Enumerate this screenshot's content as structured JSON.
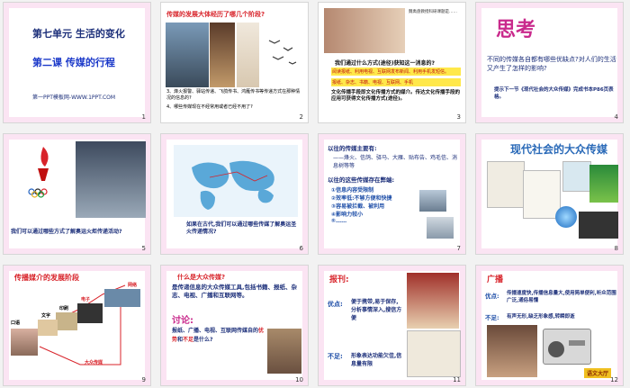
{
  "slides": [
    {
      "num": "1",
      "title": "第七单元  生活的变化",
      "subtitle": "第二课  传媒的行程",
      "footer": "第一PPT模板网-WWW.1PPT.COM"
    },
    {
      "num": "2",
      "question": "传媒的发展大体经历了哪几个阶段?",
      "note": "中国古代烽火台\n中国古代飞鸽传书",
      "q3": "3、烽火报警、驿站传递、飞鸽传书、鸿雁传书等传递方式在那种情况的信息的?",
      "q4": "4、哪些传媒现在不经常用或者已经不用了?"
    },
    {
      "num": "3",
      "bio": "魏禹盘教授科研课题是……",
      "q1": "我们通过什么方式(途径)获知这一消息的?",
      "b1": "阅读报纸、利用电视、互联网发布新闻、利用手机发短信。",
      "b2": "报纸、杂志、书籍、电视、互联网、手机",
      "para": "文化传播手段即文化传播方式的媒介。传达文化传播手段的应用可获得文化传播方式(途径)。"
    },
    {
      "num": "4",
      "big": "思考",
      "q": "不同的传媒各自都有哪些优缺点?对人们的生活又产生了怎样的影响?",
      "hint": "提示下一节《现代社会的大众传媒》完成书本P86页表格。"
    },
    {
      "num": "5",
      "q": "我们可以通过哪些方式了解奥运火炬传递活动?"
    },
    {
      "num": "6",
      "q": "如果在古代,我们可以通过哪些传媒了解奥运圣火传递情况?"
    },
    {
      "num": "7",
      "h1": "以往的传媒主要有:",
      "l1": "——烽火、信鸽、驿马、大雁、贴布告、鸡毛信、消息树等等",
      "h2": "以往的这些传媒存在弊端:",
      "items": [
        "①信息内容受限制",
        "②效率低:不够方便和快捷",
        "③容易被拦截、被利用",
        "④影响力较小",
        "⑤……"
      ]
    },
    {
      "num": "8",
      "title": "现代社会的大众传媒"
    },
    {
      "num": "9",
      "title": "传播媒介的发展阶段",
      "labels": [
        "口语",
        "文字",
        "印刷",
        "电子",
        "网络",
        "大众传媒"
      ]
    },
    {
      "num": "10",
      "q": "什么是大众传媒?",
      "def": "是传递信息的大众传媒工具,包括书籍、报纸、杂志、电视、广播和互联网等。",
      "disc": "讨论:",
      "dq": "报纸、广播、电视、互联网传媒自的",
      "dq2": "优势",
      "dq3": "和",
      "dq4": "不足",
      "dq5": "是什么?"
    },
    {
      "num": "11",
      "h": "报刊:",
      "adv_l": "优点:",
      "adv": "便于携带,易于保存,分析事情深入,搜信方便",
      "dis_l": "不足:",
      "dis": "形象表达功能欠佳,信息量有限"
    },
    {
      "num": "12",
      "h": "广播",
      "adv_l": "优点:",
      "adv": "传播速度快,传播信息量大,使用简单便利,听众范围广泛,通俗易懂",
      "dis_l": "不足:",
      "dis": "有声无形,缺乏形象感,转瞬即逝",
      "badge": "语文大厅"
    }
  ]
}
